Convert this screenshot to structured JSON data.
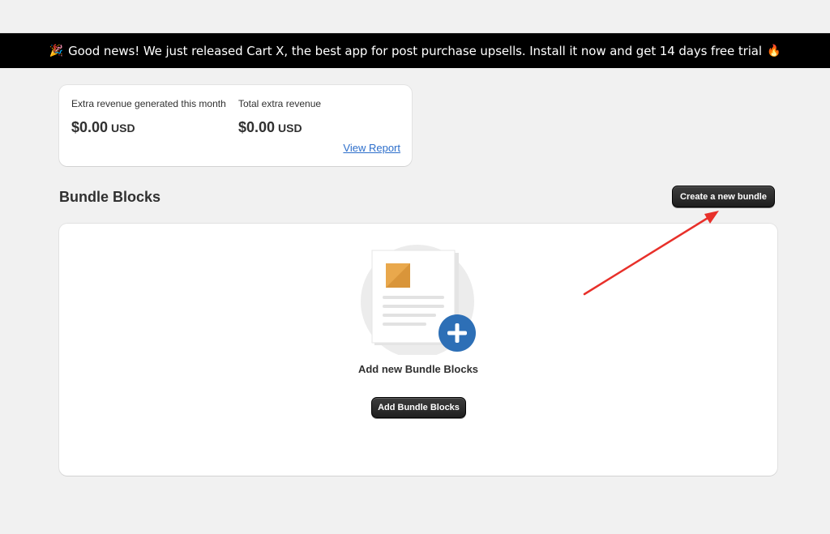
{
  "banner": {
    "left_emoji": "🎉",
    "text": "Good news! We just released Cart X, the best app for post purchase upsells. Install it now and get 14 days free trial",
    "right_emoji": "🔥"
  },
  "revenue": {
    "month": {
      "label": "Extra revenue generated this month",
      "amount": "$0.00",
      "currency": "USD"
    },
    "total": {
      "label": "Total extra revenue",
      "amount": "$0.00",
      "currency": "USD"
    },
    "view_report": "View Report"
  },
  "bundle_blocks": {
    "title": "Bundle Blocks",
    "create_button": "Create a new bundle",
    "empty_title": "Add new Bundle Blocks",
    "add_button": "Add Bundle Blocks",
    "illustration_icon": "document-plus-icon"
  },
  "colors": {
    "banner_bg": "#000000",
    "link": "#2c6ecb",
    "plus_circle": "#2d6fb6",
    "image_tile": "#e9a84c",
    "annotation_arrow": "#e8302a"
  }
}
